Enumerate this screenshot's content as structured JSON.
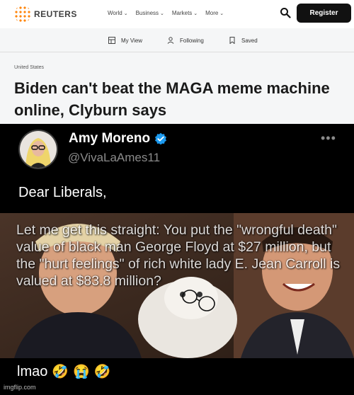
{
  "reuters": {
    "brand": "REUTERS",
    "nav": [
      "World",
      "Business",
      "Markets",
      "More"
    ],
    "register_label": "Register",
    "subnav": [
      "My View",
      "Following",
      "Saved"
    ],
    "kicker": "United States",
    "headline": "Biden can't beat the MAGA meme machine online, Clyburn says"
  },
  "tweet": {
    "author": "Amy Moreno",
    "handle": "@VivaLaAmes11",
    "more": "•••",
    "text": "Dear Liberals,",
    "meme_text": "Let me get this straight: You put the \"wrongful death\" value of black man George Floyd at $27 million, but the \"hurt feelings\" of rich white lady E. Jean Carroll is valued at $83.8 million?",
    "reply": "lmao",
    "emojis": [
      "🤣",
      "😭",
      "🤣"
    ]
  },
  "watermark": "imgflip.com",
  "colors": {
    "reuters_orange": "#ff8000",
    "verified_blue": "#1d9bf0"
  }
}
